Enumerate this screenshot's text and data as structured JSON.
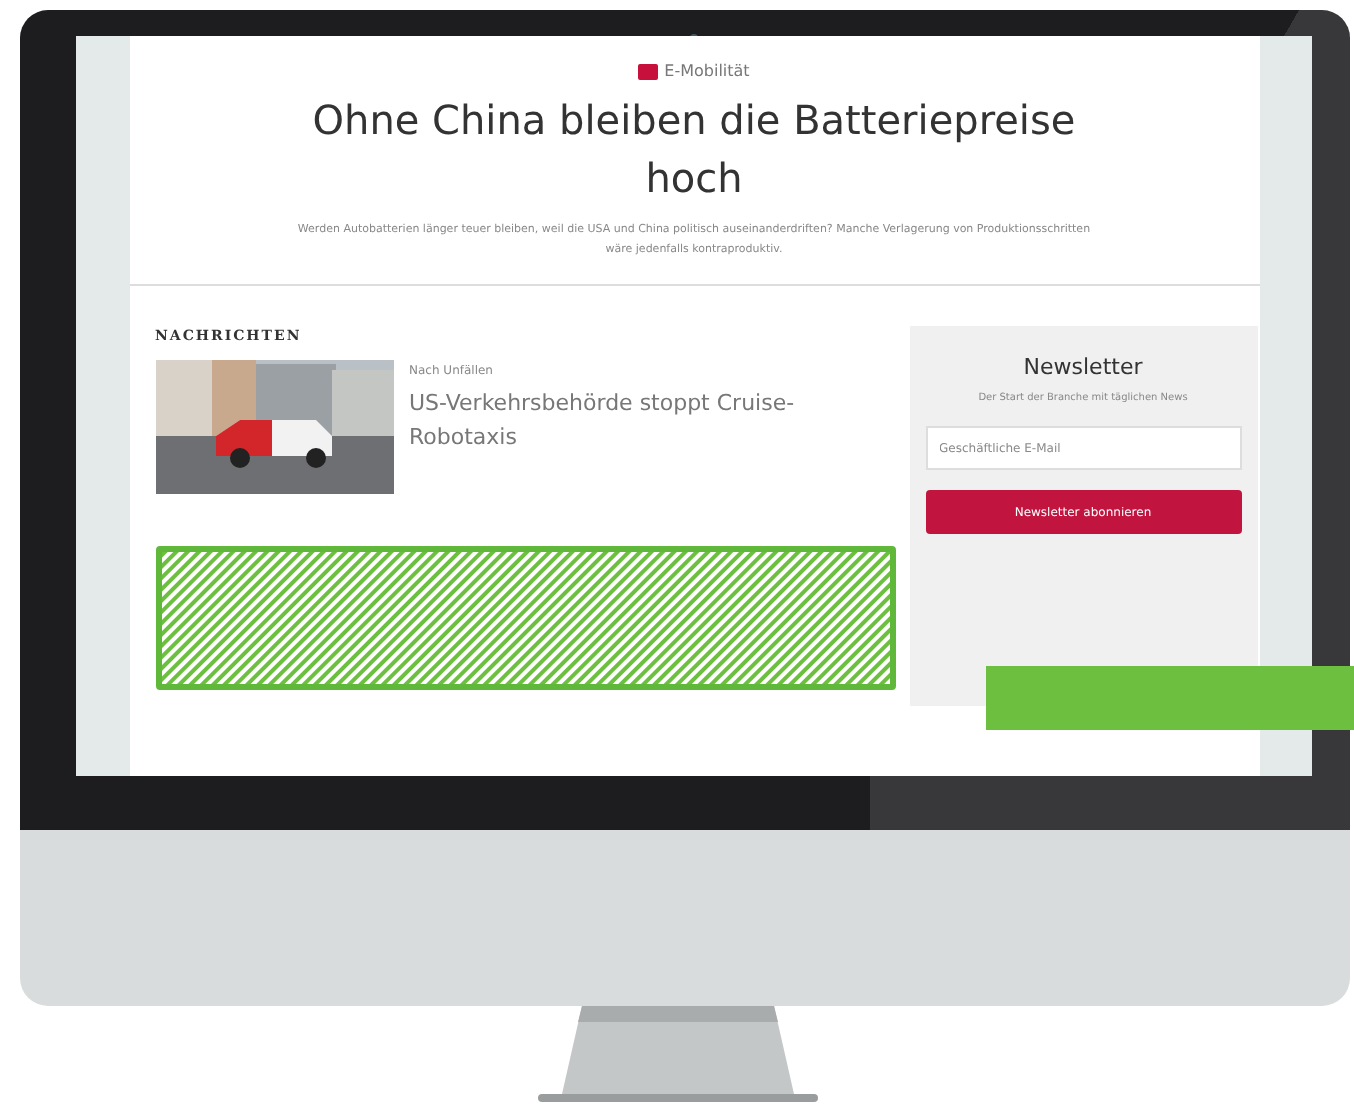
{
  "page": {
    "category": "E-Mobilität",
    "title": "Ohne China bleiben die Batteriepreise hoch",
    "teaser": "Werden Autobatterien länger teuer bleiben, weil die USA und China politisch auseinanderdriften? Manche Verlagerung von Produktionsschritten wäre jedenfalls kontraproduktiv."
  },
  "news": {
    "heading": "NACHRICHTEN",
    "items": [
      {
        "kicker": "Nach Unfällen",
        "headline": "US-Verkehrsbehörde stoppt Cruise-Robotaxis",
        "kind": "picture"
      }
    ]
  },
  "newsletter": {
    "title": "Newsletter",
    "subtitle": "Der Start der Branche mit täglichen News",
    "email": {
      "placeholder": "Geschäftliche E-Mail"
    },
    "button": "Newsletter abonnieren"
  }
}
